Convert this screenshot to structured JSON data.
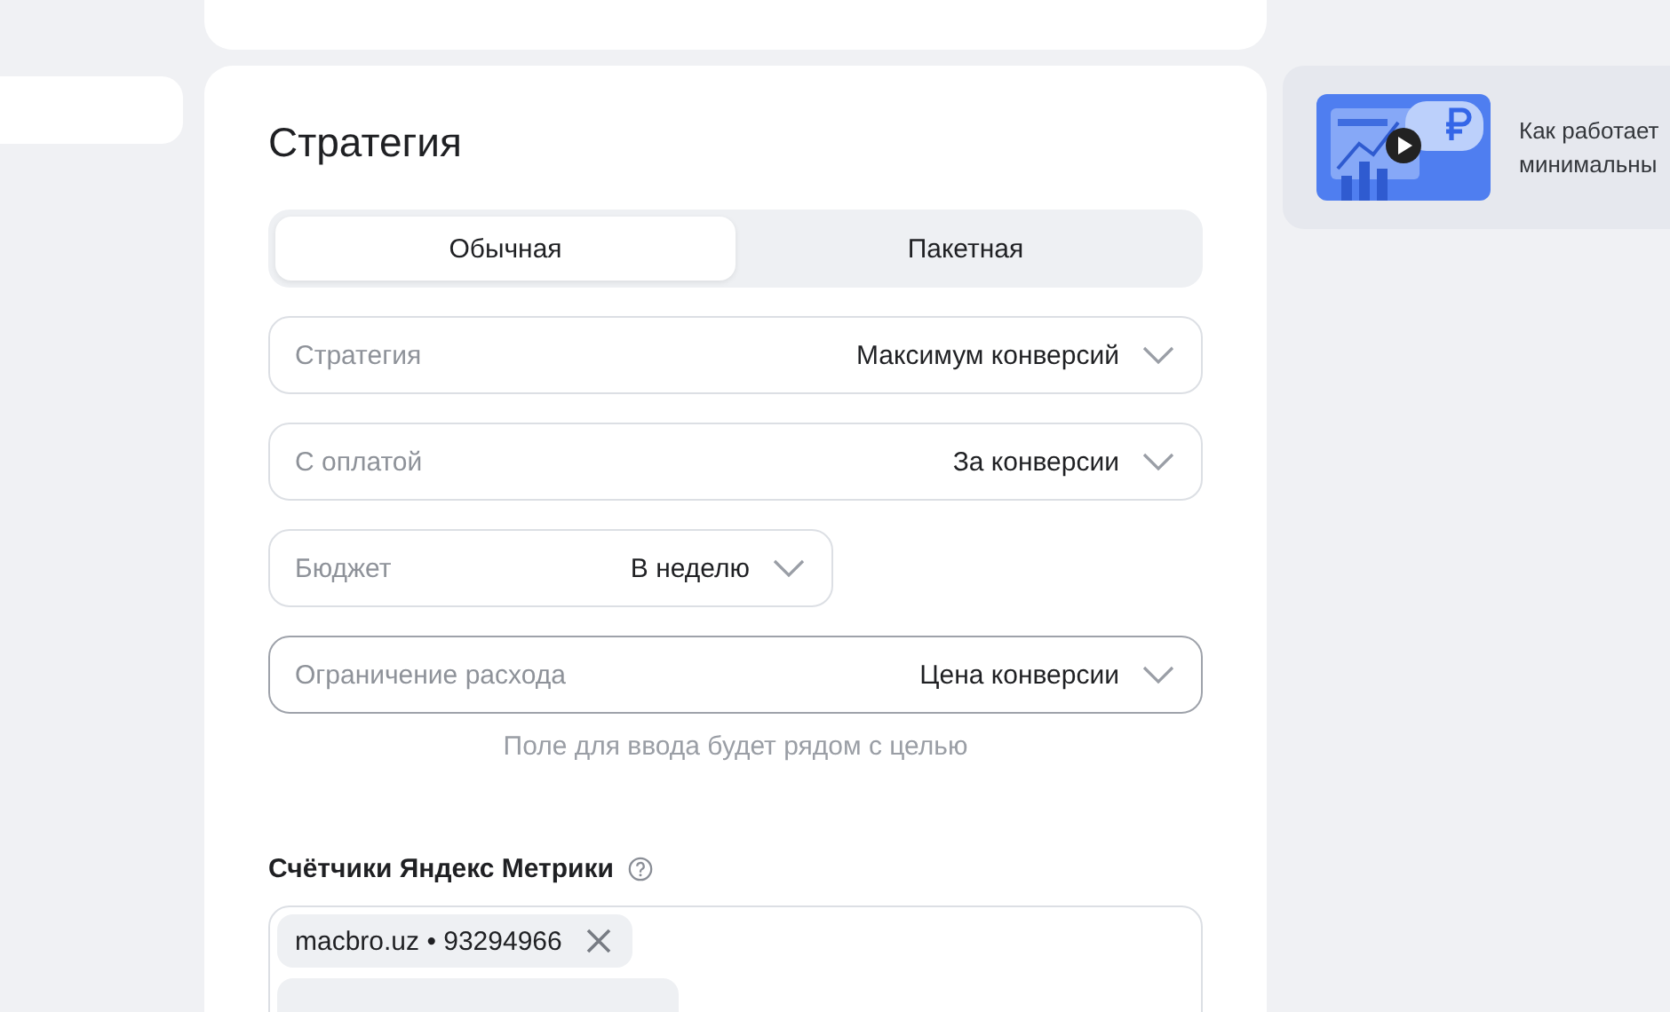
{
  "strategy": {
    "title": "Стратегия",
    "tabs": [
      {
        "label": "Обычная",
        "selected": true
      },
      {
        "label": "Пакетная",
        "selected": false
      }
    ],
    "selects": [
      {
        "label": "Стратегия",
        "value": "Максимум конверсий",
        "kind": "wide",
        "focused": false
      },
      {
        "label": "С оплатой",
        "value": "За конверсии",
        "kind": "wide",
        "focused": false
      },
      {
        "label": "Бюджет",
        "value": "В неделю",
        "kind": "narrow",
        "focused": false
      },
      {
        "label": "Ограничение расхода",
        "value": "Цена конверсии",
        "kind": "wide",
        "focused": true
      }
    ],
    "hint": "Поле для ввода будет рядом с целью"
  },
  "counters": {
    "title": "Счётчики Яндекс Метрики",
    "tags": [
      {
        "label": "macbro.uz • 93294966"
      }
    ]
  },
  "promo": {
    "text_lines": [
      "Как работает",
      "минимальны"
    ]
  }
}
